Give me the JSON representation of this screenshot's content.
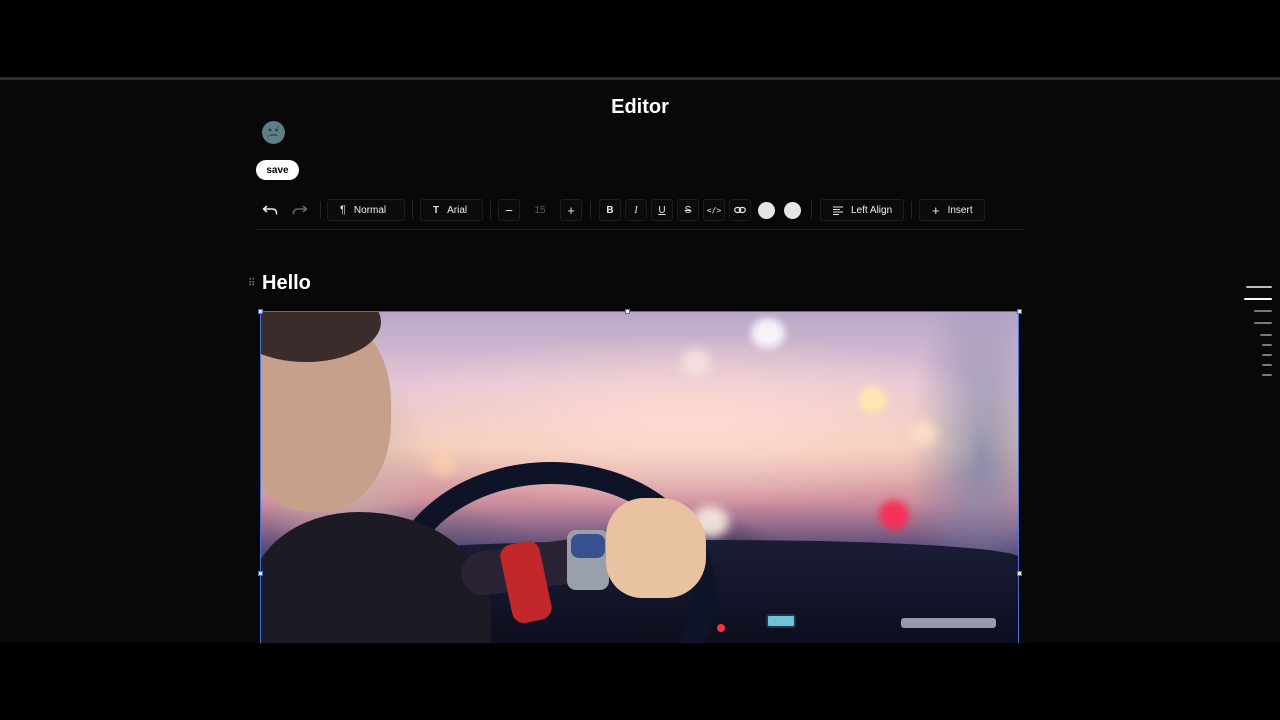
{
  "editor": {
    "title": "Editor",
    "save_label": "save",
    "theme_icon": "moon-face-icon"
  },
  "toolbar": {
    "block_type": "Normal",
    "font_family": "Arial",
    "font_size": "15",
    "align_label": "Left Align",
    "insert_label": "Insert",
    "text_color": "#e6e6e6",
    "highlight_color": "#e6e6e6",
    "icons": {
      "undo": "undo-icon",
      "redo": "redo-icon",
      "paragraph": "paragraph-icon",
      "font": "font-icon",
      "decrease": "minus-icon",
      "increase": "plus-icon",
      "bold": "B",
      "italic": "I",
      "underline": "U",
      "strike": "S",
      "code": "code-icon",
      "link": "link-icon",
      "align": "align-left-icon",
      "insert": "plus-icon"
    }
  },
  "document": {
    "heading": "Hello",
    "image_alt": "Person driving a car at dusk with blurred city lights"
  },
  "colors": {
    "background": "#080808",
    "selection_border": "#4a6fd6",
    "save_button_bg": "#ffffff"
  }
}
